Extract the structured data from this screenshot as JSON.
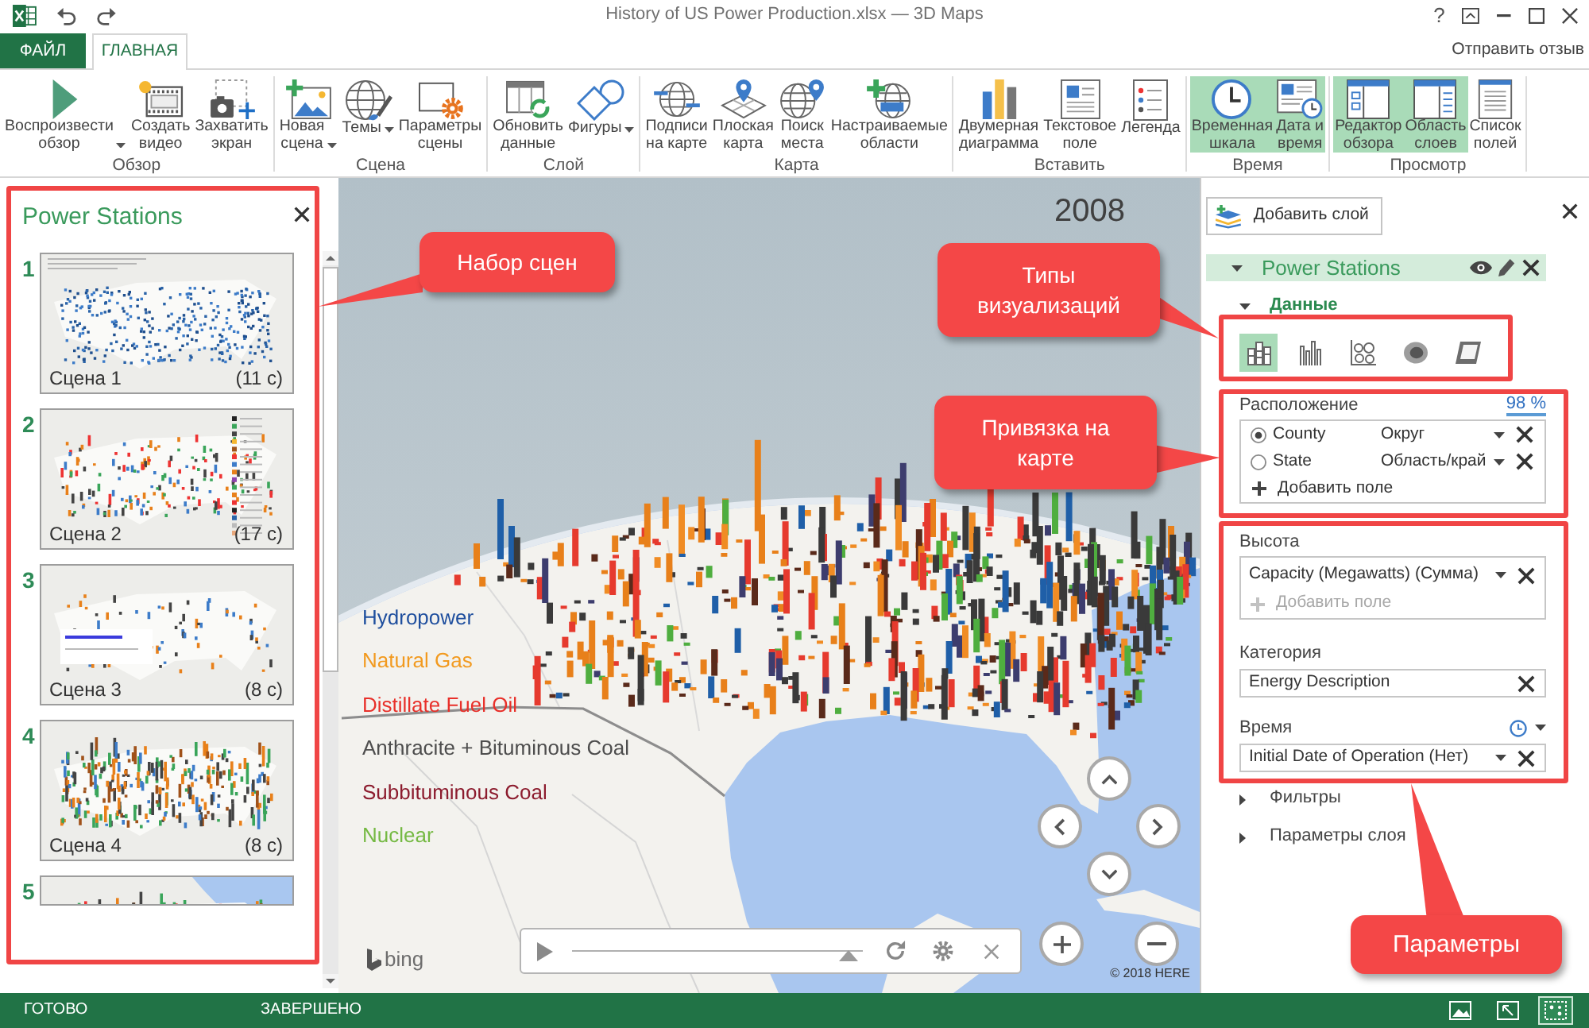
{
  "window": {
    "title": "History of US Power Production.xlsx — 3D Maps",
    "help": "?"
  },
  "ribbon_tabs": [
    {
      "label": "ФАЙЛ",
      "kind": "file",
      "selected": false
    },
    {
      "label": "ГЛАВНАЯ",
      "kind": "tab",
      "selected": true
    }
  ],
  "feedback": "Отправить отзыв",
  "ribbon_groups": [
    {
      "label": "Обзор",
      "buttons": [
        {
          "label": "Воспроизвести обзор",
          "dropdown": true
        },
        {
          "label": "Создать видео"
        },
        {
          "label": "Захватить экран"
        }
      ]
    },
    {
      "label": "Сцена",
      "buttons": [
        {
          "label": "Новая сцена",
          "dropdown": true
        },
        {
          "label": "Темы",
          "dropdown": true
        },
        {
          "label": "Параметры сцены"
        }
      ]
    },
    {
      "label": "Слой",
      "buttons": [
        {
          "label": "Обновить данные"
        },
        {
          "label": "Фигуры",
          "dropdown": true
        }
      ]
    },
    {
      "label": "Карта",
      "buttons": [
        {
          "label": "Подписи на карте"
        },
        {
          "label": "Плоская карта"
        },
        {
          "label": "Поиск места"
        },
        {
          "label": "Настраиваемые области"
        }
      ]
    },
    {
      "label": "Вставить",
      "buttons": [
        {
          "label": "Двумерная диаграмма"
        },
        {
          "label": "Текстовое поле"
        },
        {
          "label": "Легенда"
        }
      ]
    },
    {
      "label": "Время",
      "buttons": [
        {
          "label": "Временная шкала",
          "on": true
        },
        {
          "label": "Дата и время",
          "on": true
        }
      ]
    },
    {
      "label": "Просмотр",
      "buttons": [
        {
          "label": "Редактор обзора",
          "on": true
        },
        {
          "label": "Область слоев",
          "on": true
        },
        {
          "label": "Список полей",
          "on": false
        }
      ]
    }
  ],
  "scene_panel": {
    "title": "Power Stations",
    "scenes": [
      {
        "number": "1",
        "name": "Сцена 1",
        "duration": "(11 с)"
      },
      {
        "number": "2",
        "name": "Сцена 2",
        "duration": "(17 с)"
      },
      {
        "number": "3",
        "name": "Сцена 3",
        "duration": "(8 с)"
      },
      {
        "number": "4",
        "name": "Сцена 4",
        "duration": "(8 с)"
      },
      {
        "number": "5"
      }
    ]
  },
  "map": {
    "year": "2008",
    "legend": [
      {
        "label": "Hydropower",
        "color": "#1f4f9e"
      },
      {
        "label": "Natural Gas",
        "color": "#f29a1f"
      },
      {
        "label": "Distillate Fuel Oil",
        "color": "#e8302a"
      },
      {
        "label": "Anthracite + Bituminous Coal",
        "color": "#4d4d4d"
      },
      {
        "label": "Subbituminous Coal",
        "color": "#8c1c2e"
      },
      {
        "label": "Nuclear",
        "color": "#75b943"
      }
    ],
    "logo": "bing",
    "attribution": "© 2018 HERE",
    "player": {
      "level": 0.95
    }
  },
  "layer_panel": {
    "add_layer": "Добавить слой",
    "layer": {
      "name": "Power Stations",
      "expanded": true
    },
    "data_section": {
      "label": "Данные",
      "expanded": true
    },
    "vis_types": [
      {
        "selected": true
      },
      {
        "selected": false
      },
      {
        "selected": false
      },
      {
        "selected": false
      },
      {
        "selected": false
      }
    ],
    "location": {
      "label": "Расположение",
      "match": "98 %",
      "fields": [
        {
          "name": "County",
          "type": "Округ",
          "selected": true
        },
        {
          "name": "State",
          "type": "Область/край",
          "selected": false
        }
      ],
      "add_field": {
        "label": "Добавить поле",
        "disabled": false
      }
    },
    "height": {
      "label": "Высота",
      "fields": [
        {
          "name": "Capacity (Megawatts) (Сумма)"
        }
      ],
      "add_field": {
        "label": "Добавить поле",
        "disabled": true
      }
    },
    "category": {
      "label": "Категория",
      "value": "Energy Description"
    },
    "time": {
      "label": "Время",
      "value": "Initial Date of Operation (Нет)"
    },
    "sections": [
      {
        "label": "Фильтры",
        "expanded": false
      },
      {
        "label": "Параметры слоя",
        "expanded": false
      }
    ]
  },
  "annotations": [
    {
      "text": "Набор сцен"
    },
    {
      "text": "Типы визуализаций"
    },
    {
      "text": "Привязка на карте"
    },
    {
      "text": "Параметры"
    }
  ],
  "status_bar": {
    "status": "ГОТОВО",
    "progress": "ЗАВЕРШЕНО",
    "views": [
      {
        "selected": false
      },
      {
        "selected": false
      },
      {
        "selected": true
      }
    ]
  }
}
